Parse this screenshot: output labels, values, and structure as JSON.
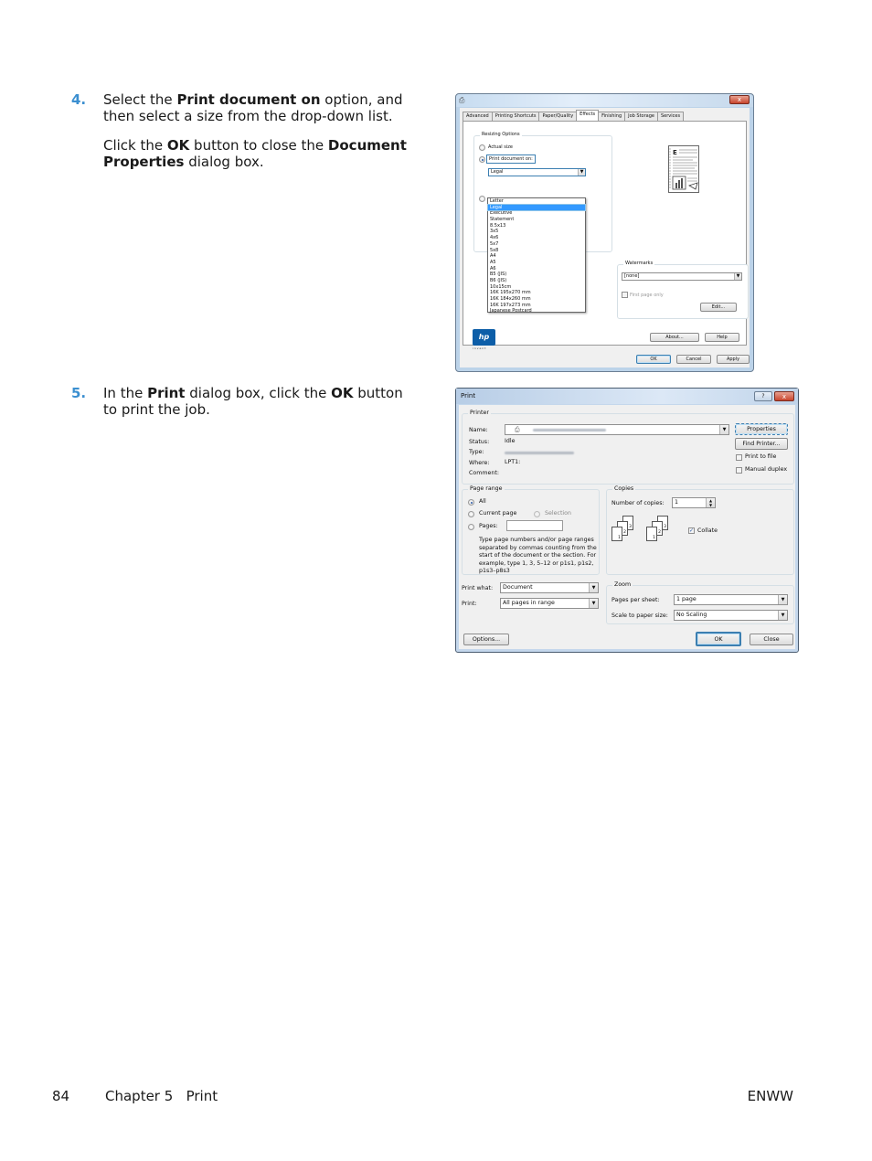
{
  "steps": [
    {
      "number": "4.",
      "paragraphs": [
        {
          "parts": [
            "Select the ",
            "Print document on",
            " option, and then select a size from the drop-down list."
          ]
        },
        {
          "parts": [
            "Click the ",
            "OK",
            " button to close the ",
            "Document Properties",
            " dialog box."
          ]
        }
      ]
    },
    {
      "number": "5.",
      "paragraphs": [
        {
          "parts": [
            "In the ",
            "Print",
            " dialog box, click the ",
            "OK",
            " button to print the job."
          ]
        }
      ]
    }
  ],
  "footer": {
    "page_number": "84",
    "chapter": "Chapter 5   Print",
    "right": "ENWW"
  },
  "document_properties": {
    "title_icon": "printer-icon",
    "close_glyph": "x",
    "tabs": [
      "Advanced",
      "Printing Shortcuts",
      "Paper/Quality",
      "Effects",
      "Finishing",
      "Job Storage",
      "Services"
    ],
    "active_tab": "Effects",
    "resizing": {
      "label": "Resizing Options",
      "actual_size": "Actual size",
      "print_document_on": "Print document on:",
      "selected_size": "Legal",
      "size_options": [
        "Letter",
        "Legal",
        "Executive",
        "Statement",
        "8.5x13",
        "3x5",
        "4x6",
        "5x7",
        "5x8",
        "A4",
        "A5",
        "A6",
        "B5 (JIS)",
        "B6 (JIS)",
        "10x15cm",
        "16K 195x270 mm",
        "16K 184x260 mm",
        "16K 197x273 mm",
        "Japanese Postcard"
      ],
      "highlighted_option": "Legal"
    },
    "watermarks": {
      "label": "Watermarks",
      "value": "[none]",
      "first_page_only": "First page only",
      "first_page_only_checked": false,
      "edit_button": "Edit..."
    },
    "logo": {
      "text": "hp",
      "subtext": "invent"
    },
    "buttons": {
      "about": "About...",
      "help": "Help",
      "ok": "OK",
      "cancel": "Cancel",
      "apply": "Apply"
    }
  },
  "print_dialog": {
    "title": "Print",
    "help_glyph": "?",
    "close_glyph": "x",
    "printer": {
      "group_label": "Printer",
      "name_label": "Name:",
      "status_label": "Status:",
      "status_value": "Idle",
      "type_label": "Type:",
      "where_label": "Where:",
      "where_value": "LPT1:",
      "comment_label": "Comment:",
      "properties_button": "Properties",
      "find_printer_button": "Find Printer...",
      "print_to_file": "Print to file",
      "manual_duplex": "Manual duplex"
    },
    "page_range": {
      "group_label": "Page range",
      "all": "All",
      "current_page": "Current page",
      "selection": "Selection",
      "pages": "Pages:",
      "pages_value": "",
      "hint": "Type page numbers and/or page ranges separated by commas counting from the start of the document or the section. For example, type 1, 3, 5–12 or p1s1, p1s2, p1s3–p8s3",
      "selected": "All"
    },
    "copies": {
      "group_label": "Copies",
      "number_label": "Number of copies:",
      "number_value": "1",
      "collate": "Collate",
      "collate_checked": true,
      "stack_pages": [
        "1",
        "2",
        "3"
      ]
    },
    "print_what_label": "Print what:",
    "print_what_value": "Document",
    "print_label": "Print:",
    "print_value": "All pages in range",
    "zoom": {
      "group_label": "Zoom",
      "pages_per_sheet_label": "Pages per sheet:",
      "pages_per_sheet_value": "1 page",
      "scale_label": "Scale to paper size:",
      "scale_value": "No Scaling"
    },
    "buttons": {
      "options": "Options...",
      "ok": "OK",
      "close": "Close"
    }
  }
}
